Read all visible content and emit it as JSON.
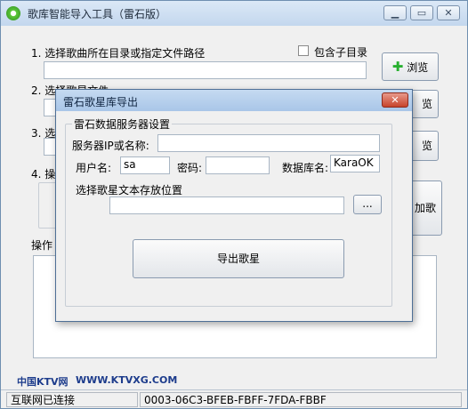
{
  "window": {
    "title": "歌库智能导入工具（雷石版）",
    "minimize_glyph": "▁",
    "restore_glyph": "▭",
    "close_glyph": "✕"
  },
  "main": {
    "step1_label": "1. 选择歌曲所在目录或指定文件路径",
    "include_subdirs_label": "包含子目录",
    "browse_label": "浏览",
    "step2_label": "2. 选择歌星文件",
    "step2_browse_label": "览",
    "step3_label": "3. 选",
    "step3_browse_label": "览",
    "step4_label": "4. 操",
    "add_songs_label": "加歌",
    "log_label": "操作"
  },
  "dialog": {
    "title": "雷石歌星库导出",
    "close_glyph": "✕",
    "group_label": "雷石数据服务器设置",
    "server_label": "服务器IP或名称:",
    "server_value": "",
    "user_label": "用户名:",
    "user_value": "sa",
    "password_label": "密码:",
    "password_value": "",
    "db_label": "数据库名:",
    "db_value": "KaraOK",
    "path_label": "选择歌星文本存放位置",
    "path_value": "",
    "path_browse_label": "...",
    "export_label": "导出歌星"
  },
  "footer": {
    "brand_cn": "中国KTV网",
    "brand_url": "WWW.KTVXG.COM"
  },
  "status": {
    "connection": "互联网已连接",
    "machine_code": "0003-06C3-BFEB-FBFF-7FDA-FBBF"
  },
  "colors": {
    "accent_green": "#28b030",
    "brand_blue": "#1d3c8c"
  }
}
